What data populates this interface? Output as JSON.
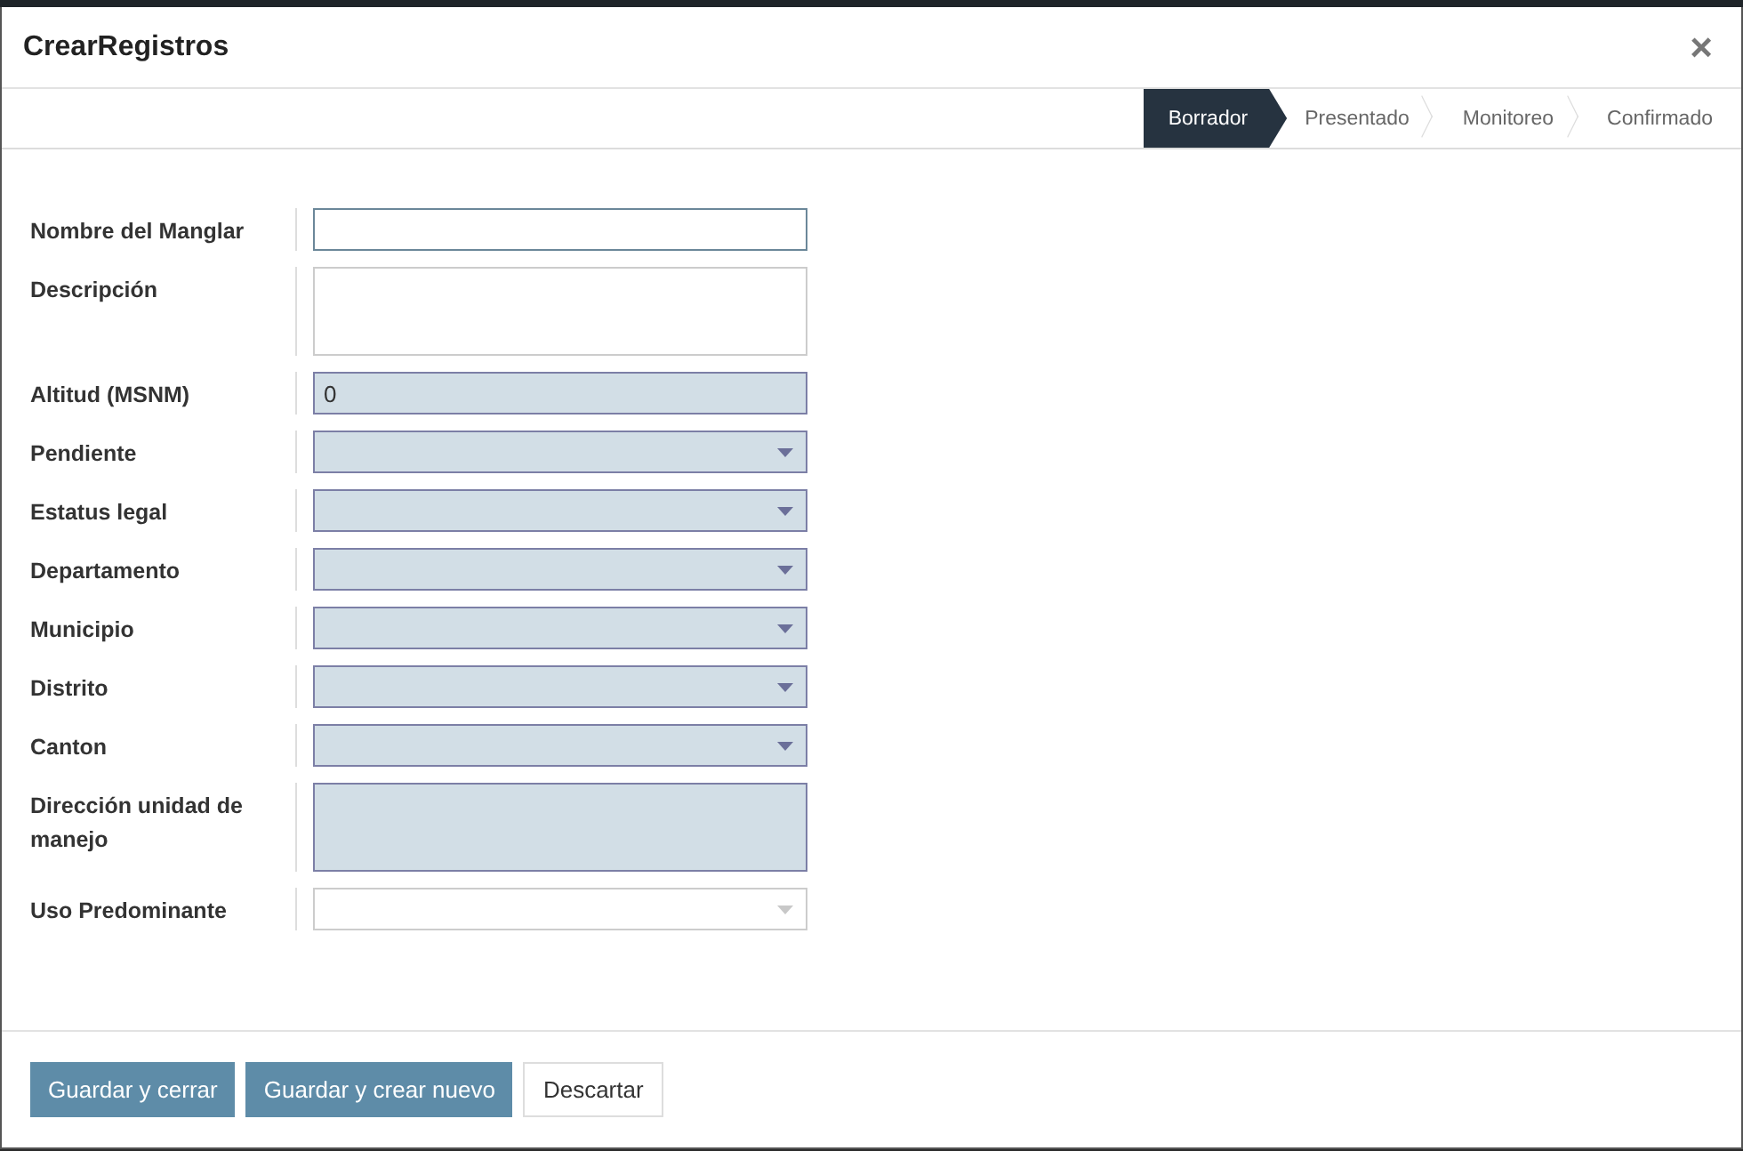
{
  "dialog": {
    "title": "CrearRegistros",
    "close": "×"
  },
  "stages": [
    {
      "label": "Borrador",
      "selected": true
    },
    {
      "label": "Presentado",
      "selected": false
    },
    {
      "label": "Monitoreo",
      "selected": false
    },
    {
      "label": "Confirmado",
      "selected": false
    }
  ],
  "fields": [
    {
      "label": "Nombre del Manglar",
      "kind": "text",
      "required": false,
      "focused": true
    },
    {
      "label": "Descripción",
      "kind": "textarea",
      "required": false,
      "focused": false
    },
    {
      "label": "Altitud (MSNM)",
      "kind": "text",
      "value": "0",
      "required": true,
      "focused": false
    },
    {
      "label": "Pendiente",
      "kind": "select",
      "required": true,
      "focused": false
    },
    {
      "label": "Estatus legal",
      "kind": "select",
      "required": true,
      "focused": false
    },
    {
      "label": "Departamento",
      "kind": "select",
      "required": true,
      "focused": false
    },
    {
      "label": "Municipio",
      "kind": "select",
      "required": true,
      "focused": false
    },
    {
      "label": "Distrito",
      "kind": "select",
      "required": true,
      "focused": false
    },
    {
      "label": "Canton",
      "kind": "select",
      "required": true,
      "focused": false
    },
    {
      "label": "Dirección unidad de manejo",
      "kind": "textarea",
      "required": true,
      "focused": false
    },
    {
      "label": "Uso Predominante",
      "kind": "select",
      "required": false,
      "focused": false
    }
  ],
  "buttons": [
    {
      "label": "Guardar y cerrar",
      "kind": "primary"
    },
    {
      "label": "Guardar y crear nuevo",
      "kind": "primary"
    },
    {
      "label": "Descartar",
      "kind": "secondary"
    }
  ]
}
